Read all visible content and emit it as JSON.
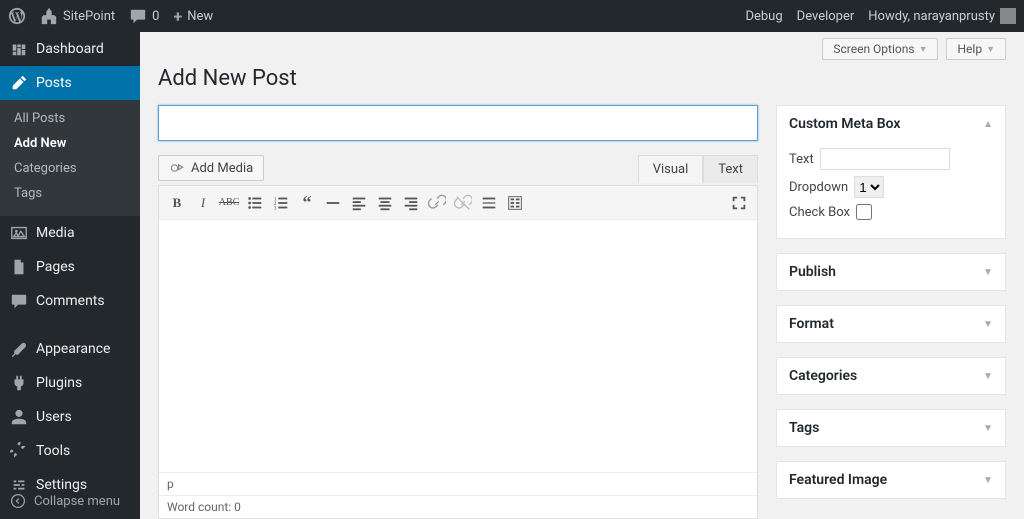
{
  "adminbar": {
    "site": "SitePoint",
    "comments": "0",
    "new": "New",
    "debug": "Debug",
    "developer": "Developer",
    "howdy": "Howdy, narayanprusty"
  },
  "sidebar": {
    "dashboard": "Dashboard",
    "posts": "Posts",
    "posts_sub": {
      "all": "All Posts",
      "add": "Add New",
      "cat": "Categories",
      "tags": "Tags"
    },
    "media": "Media",
    "pages": "Pages",
    "comments": "Comments",
    "appearance": "Appearance",
    "plugins": "Plugins",
    "users": "Users",
    "tools": "Tools",
    "settings": "Settings",
    "collapse": "Collapse menu"
  },
  "top": {
    "screen_options": "Screen Options",
    "help": "Help"
  },
  "page_title": "Add New Post",
  "editor": {
    "add_media": "Add Media",
    "visual": "Visual",
    "text": "Text",
    "path": "p",
    "word_count": "Word count: 0"
  },
  "meta": {
    "custom": {
      "title": "Custom Meta Box",
      "text_label": "Text",
      "dropdown_label": "Dropdown",
      "dropdown_value": "1",
      "checkbox_label": "Check Box"
    },
    "publish": "Publish",
    "format": "Format",
    "categories": "Categories",
    "tags": "Tags",
    "featured": "Featured Image"
  }
}
